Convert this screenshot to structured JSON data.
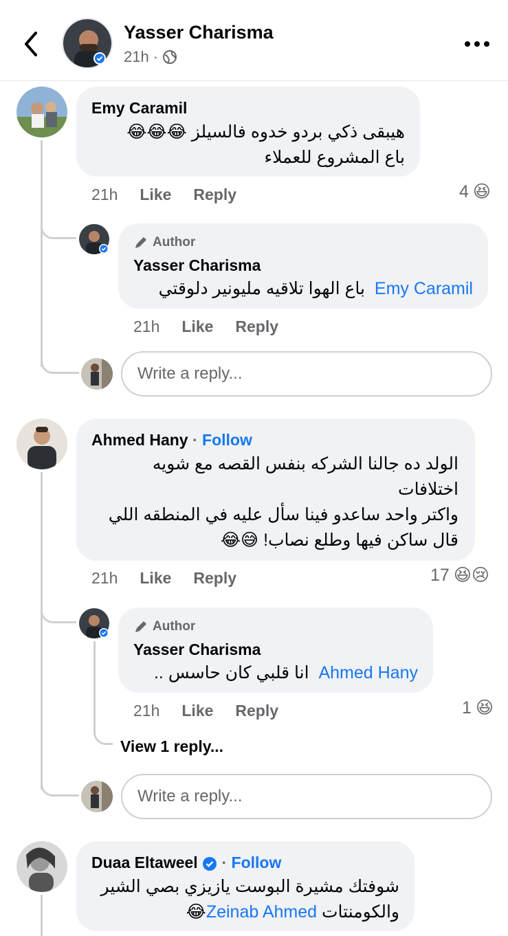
{
  "header": {
    "name": "Yasser Charisma",
    "time": "21h",
    "dot": "·"
  },
  "colors": {
    "accent": "#1877f2",
    "bubble": "#f0f2f5",
    "muted": "#65676b"
  },
  "comments": [
    {
      "name": "Emy Caramil",
      "lines": [
        "هيبقى ذكي بردو خدوه فالسيلز 😂😂😂",
        "باع المشروع للعملاء"
      ],
      "time": "21h",
      "like": "Like",
      "reply": "Reply",
      "reaction_count": "4",
      "reaction_icons": "😆",
      "replies": [
        {
          "author_tag": "Author",
          "name": "Yasser Charisma",
          "mention": "Emy Caramil",
          "text": "باع الهوا تلاقيه مليونير دلوقتي",
          "time": "21h",
          "like": "Like",
          "reply": "Reply"
        }
      ],
      "reply_placeholder": "Write a reply..."
    },
    {
      "name": "Ahmed Hany",
      "follow": "Follow",
      "lines": [
        "الولد ده جالنا الشركه بنفس القصه مع شويه",
        "اختلافات",
        "واكتر واحد ساعدو فينا سأل عليه في المنطقه اللي",
        "قال ساكن فيها وطلع نصاب! 😅😂"
      ],
      "time": "21h",
      "like": "Like",
      "reply": "Reply",
      "reaction_count": "17",
      "reaction_icons": "😆😢",
      "replies": [
        {
          "author_tag": "Author",
          "name": "Yasser Charisma",
          "mention": "Ahmed Hany",
          "text": "انا قلبي كان حاسس ..",
          "time": "21h",
          "like": "Like",
          "reply": "Reply",
          "reaction_count": "1",
          "reaction_icons": "😆"
        }
      ],
      "view_replies": "View 1 reply...",
      "reply_placeholder": "Write a reply..."
    },
    {
      "name": "Duaa Eltaweel",
      "follow": "Follow",
      "lines": [
        "شوفتك مشيرة البوست يازيزي بصي الشير",
        "والكومنتات"
      ],
      "mention": "Zeinab Ahmed",
      "emoji": "😂"
    }
  ]
}
